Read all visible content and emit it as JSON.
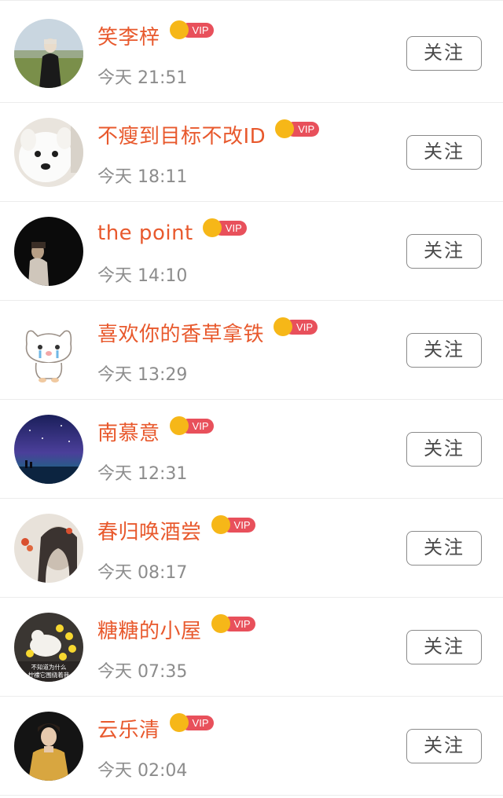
{
  "follow_label": "关注",
  "vip_label": "VIP",
  "colors": {
    "name": "#e8592d",
    "time": "#8c8c8c",
    "vip_pill": "#e8505b",
    "vip_crown": "#f6b718"
  },
  "users": [
    {
      "name": "笑李梓",
      "time": "今天 21:51",
      "avatar_icon": "photo-girl-field-avatar"
    },
    {
      "name": "不瘦到目标不改ID",
      "time": "今天 18:11",
      "avatar_icon": "white-dog-avatar"
    },
    {
      "name": "the point",
      "time": "今天 14:10",
      "avatar_icon": "dark-portrait-avatar"
    },
    {
      "name": "喜欢你的香草拿铁",
      "time": "今天 13:29",
      "avatar_icon": "crying-cartoon-cat-avatar"
    },
    {
      "name": "南慕意",
      "time": "今天 12:31",
      "avatar_icon": "night-sky-avatar"
    },
    {
      "name": "春归唤酒尝",
      "time": "今天 08:17",
      "avatar_icon": "sketch-portrait-avatar"
    },
    {
      "name": "糖糖的小屋",
      "time": "今天 07:35",
      "avatar_icon": "cat-lemons-avatar",
      "avatar_caption": [
        "不知道为什么",
        "柠檬它围绕着我"
      ]
    },
    {
      "name": "云乐清",
      "time": "今天 02:04",
      "avatar_icon": "costume-portrait-avatar"
    }
  ]
}
